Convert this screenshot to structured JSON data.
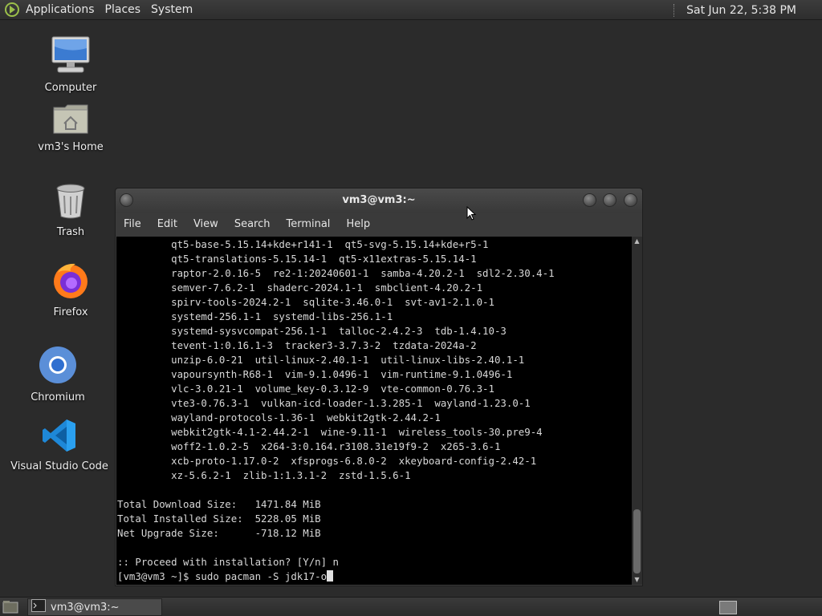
{
  "top_panel": {
    "menus": [
      "Applications",
      "Places",
      "System"
    ],
    "clock": "Sat Jun 22,  5:38 PM"
  },
  "desktop": {
    "icons": [
      {
        "label": "Computer",
        "icon": "computer-icon"
      },
      {
        "label": "vm3's Home",
        "icon": "home-folder-icon"
      },
      {
        "label": "Trash",
        "icon": "trash-icon"
      },
      {
        "label": "Firefox",
        "icon": "firefox-icon"
      },
      {
        "label": "Chromium",
        "icon": "chromium-icon"
      },
      {
        "label": "Visual Studio Code",
        "icon": "vscode-icon"
      }
    ]
  },
  "terminal": {
    "title": "vm3@vm3:~",
    "menu": [
      "File",
      "Edit",
      "View",
      "Search",
      "Terminal",
      "Help"
    ],
    "lines": [
      "         qt5-base-5.15.14+kde+r141-1  qt5-svg-5.15.14+kde+r5-1",
      "         qt5-translations-5.15.14-1  qt5-x11extras-5.15.14-1",
      "         raptor-2.0.16-5  re2-1:20240601-1  samba-4.20.2-1  sdl2-2.30.4-1",
      "         semver-7.6.2-1  shaderc-2024.1-1  smbclient-4.20.2-1",
      "         spirv-tools-2024.2-1  sqlite-3.46.0-1  svt-av1-2.1.0-1",
      "         systemd-256.1-1  systemd-libs-256.1-1",
      "         systemd-sysvcompat-256.1-1  talloc-2.4.2-3  tdb-1.4.10-3",
      "         tevent-1:0.16.1-3  tracker3-3.7.3-2  tzdata-2024a-2",
      "         unzip-6.0-21  util-linux-2.40.1-1  util-linux-libs-2.40.1-1",
      "         vapoursynth-R68-1  vim-9.1.0496-1  vim-runtime-9.1.0496-1",
      "         vlc-3.0.21-1  volume_key-0.3.12-9  vte-common-0.76.3-1",
      "         vte3-0.76.3-1  vulkan-icd-loader-1.3.285-1  wayland-1.23.0-1",
      "         wayland-protocols-1.36-1  webkit2gtk-2.44.2-1",
      "         webkit2gtk-4.1-2.44.2-1  wine-9.11-1  wireless_tools-30.pre9-4",
      "         woff2-1.0.2-5  x264-3:0.164.r3108.31e19f9-2  x265-3.6-1",
      "         xcb-proto-1.17.0-2  xfsprogs-6.8.0-2  xkeyboard-config-2.42-1",
      "         xz-5.6.2-1  zlib-1:1.3.1-2  zstd-1.5.6-1",
      "",
      "Total Download Size:   1471.84 MiB",
      "Total Installed Size:  5228.05 MiB",
      "Net Upgrade Size:      -718.12 MiB",
      "",
      ":: Proceed with installation? [Y/n] n"
    ],
    "prompt": "[vm3@vm3 ~]$ sudo pacman -S jdk17-o"
  },
  "taskbar": {
    "task_label": "vm3@vm3:~"
  }
}
